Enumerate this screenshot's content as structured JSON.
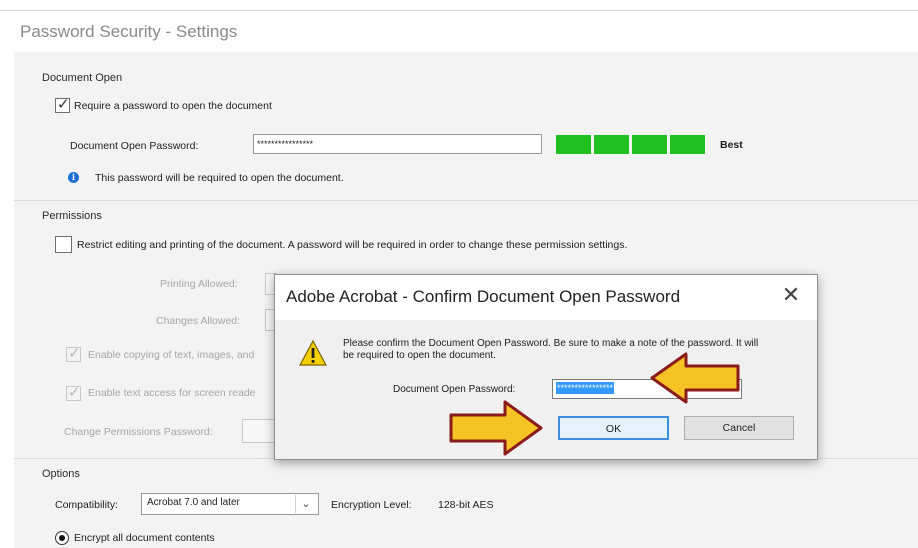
{
  "window": {
    "title": "Password Security - Settings"
  },
  "document_open": {
    "section_title": "Document Open",
    "require_password_label": "Require a password to open the document",
    "require_password_checked": true,
    "password_label": "Document Open Password:",
    "password_value": "****************",
    "strength_text": "Best",
    "strength_color": "#20c020",
    "info_text": "This password will be required to open the document."
  },
  "permissions": {
    "section_title": "Permissions",
    "restrict_label": "Restrict editing and printing of the document. A password will be required in order to change these permission settings.",
    "restrict_checked": false,
    "printing_allowed_label": "Printing Allowed:",
    "changes_allowed_label": "Changes Allowed:",
    "enable_copying_label": "Enable copying of text, images, and",
    "enable_text_access_label": "Enable text access for screen reade",
    "change_permissions_label": "Change Permissions Password:"
  },
  "options": {
    "section_title": "Options",
    "compatibility_label": "Compatibility:",
    "compatibility_value": "Acrobat 7.0 and later",
    "encryption_label": "Encryption  Level:",
    "encryption_value": "128-bit AES",
    "encrypt_all_label": "Encrypt all document contents"
  },
  "dialog": {
    "title": "Adobe Acrobat - Confirm Document Open Password",
    "close_glyph": "✕",
    "message": "Please confirm the Document Open Password. Be sure to make a note of the password. It will be required to open the document.",
    "password_label": "Document Open Password:",
    "password_value": "****************",
    "ok_label": "OK",
    "cancel_label": "Cancel"
  },
  "colors": {
    "annotation_arrow_fill": "#f6c324",
    "annotation_arrow_stroke": "#8b1a1a",
    "selection_blue": "#3399ff",
    "ok_border": "#3c8ddb"
  },
  "icons": {
    "info": "info-icon",
    "warning": "warning-icon",
    "close": "close-icon",
    "dropdown": "chevron-down-icon",
    "annotation": "arrow-icon"
  }
}
